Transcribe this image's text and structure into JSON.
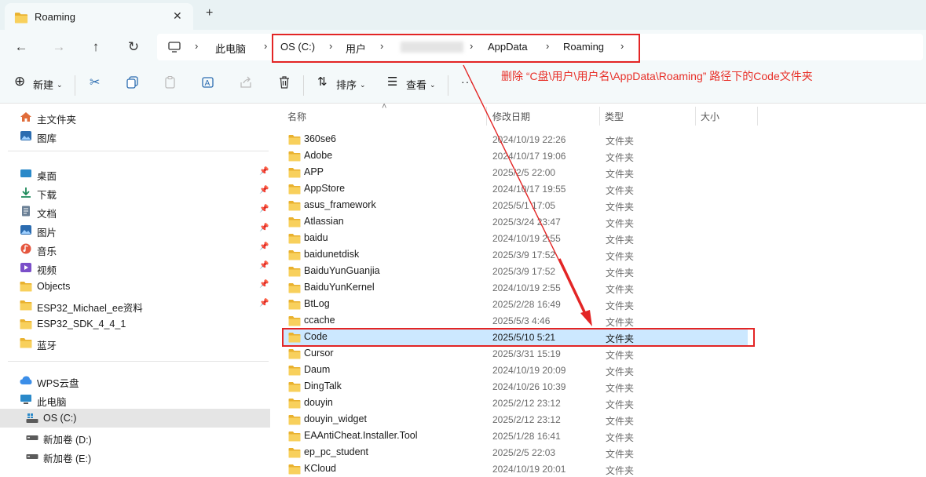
{
  "window": {
    "tab_title": "Roaming",
    "close_glyph": "✕",
    "new_tab_glyph": "+"
  },
  "nav": {
    "back": "←",
    "forward": "→",
    "up": "↑",
    "refresh": "↻"
  },
  "breadcrumbs": [
    "此电脑",
    "OS (C:)",
    "用户",
    "AppData",
    "Roaming"
  ],
  "toolbar": {
    "new_label": "新建",
    "sort_label": "排序",
    "view_label": "查看",
    "more_glyph": "···"
  },
  "annotation": "删除 “C盘\\用户\\用户名\\AppData\\Roaming” 路径下的Code文件夹",
  "sidebar": {
    "home": "主文件夹",
    "gallery": "图库",
    "pinned": [
      "桌面",
      "下载",
      "文档",
      "图片",
      "音乐",
      "视频",
      "Objects"
    ],
    "folders": [
      "ESP32_Michael_ee资料",
      "ESP32_SDK_4_4_1",
      "蓝牙"
    ],
    "cloud": "WPS云盘",
    "pc": "此电脑",
    "drives": [
      "OS (C:)",
      "新加卷 (D:)",
      "新加卷 (E:)"
    ]
  },
  "columns": {
    "name": "名称",
    "date": "修改日期",
    "type": "类型",
    "size": "大小"
  },
  "files": [
    {
      "name": "360se6",
      "date": "2024/10/19 22:26",
      "type": "文件夹"
    },
    {
      "name": "Adobe",
      "date": "2024/10/17 19:06",
      "type": "文件夹"
    },
    {
      "name": "APP",
      "date": "2025/2/5 22:00",
      "type": "文件夹"
    },
    {
      "name": "AppStore",
      "date": "2024/10/17 19:55",
      "type": "文件夹"
    },
    {
      "name": "asus_framework",
      "date": "2025/5/1 17:05",
      "type": "文件夹"
    },
    {
      "name": "Atlassian",
      "date": "2025/3/24 23:47",
      "type": "文件夹"
    },
    {
      "name": "baidu",
      "date": "2024/10/19 2:55",
      "type": "文件夹"
    },
    {
      "name": "baidunetdisk",
      "date": "2025/3/9 17:52",
      "type": "文件夹"
    },
    {
      "name": "BaiduYunGuanjia",
      "date": "2025/3/9 17:52",
      "type": "文件夹"
    },
    {
      "name": "BaiduYunKernel",
      "date": "2024/10/19 2:55",
      "type": "文件夹"
    },
    {
      "name": "BtLog",
      "date": "2025/2/28 16:49",
      "type": "文件夹"
    },
    {
      "name": "ccache",
      "date": "2025/5/3 4:46",
      "type": "文件夹"
    },
    {
      "name": "Code",
      "date": "2025/5/10 5:21",
      "type": "文件夹"
    },
    {
      "name": "Cursor",
      "date": "2025/3/31 15:19",
      "type": "文件夹"
    },
    {
      "name": "Daum",
      "date": "2024/10/19 20:09",
      "type": "文件夹"
    },
    {
      "name": "DingTalk",
      "date": "2024/10/26 10:39",
      "type": "文件夹"
    },
    {
      "name": "douyin",
      "date": "2025/2/12 23:12",
      "type": "文件夹"
    },
    {
      "name": "douyin_widget",
      "date": "2025/2/12 23:12",
      "type": "文件夹"
    },
    {
      "name": "EAAntiCheat.Installer.Tool",
      "date": "2025/1/28 16:41",
      "type": "文件夹"
    },
    {
      "name": "ep_pc_student",
      "date": "2025/2/5 22:03",
      "type": "文件夹"
    },
    {
      "name": "KCloud",
      "date": "2024/10/19 20:01",
      "type": "文件夹"
    }
  ],
  "colors": {
    "annotation_red": "#e8312a",
    "selection": "#cce8ff",
    "folder": "#f5c443"
  }
}
